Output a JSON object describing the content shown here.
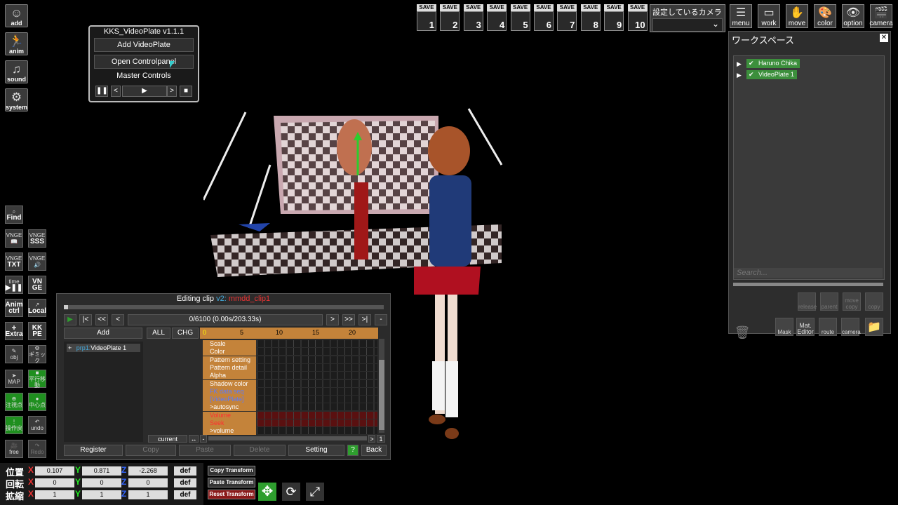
{
  "left_toolbar": [
    {
      "icon": "person-icon",
      "label": "add"
    },
    {
      "icon": "running-figure-icon",
      "label": "anim"
    },
    {
      "icon": "music-note-icon",
      "label": "sound"
    },
    {
      "icon": "gears-icon",
      "label": "system"
    }
  ],
  "left_tools": {
    "find": "Find",
    "vnge": "VNGE",
    "sss": "SSS",
    "txt": "TXT",
    "time": "time",
    "vn": "VN",
    "ge": "GE",
    "anim": "Anim",
    "ctrl": "ctrl",
    "local": "Local",
    "extra": "Extra",
    "kk": "KK",
    "pe": "PE",
    "obj": "obj",
    "gimmick": "ギミック",
    "map": "MAP",
    "move_ctrl": "平行移動",
    "rotate": "注視点",
    "center": "中心点",
    "undo": "undo",
    "undo_label": "操作戻",
    "free": "free",
    "redo": "Redo"
  },
  "save_slots": {
    "label": "SAVE",
    "numbers": [
      "1",
      "2",
      "3",
      "4",
      "5",
      "6",
      "7",
      "8",
      "9",
      "10"
    ]
  },
  "camera_dropdown": {
    "label": "設定しているカメラ",
    "value": ""
  },
  "top_tools": [
    {
      "icon": "menu-icon",
      "label": "menu"
    },
    {
      "icon": "work-icon",
      "label": "work"
    },
    {
      "icon": "hand-icon",
      "label": "move"
    },
    {
      "icon": "palette-icon",
      "label": "color"
    },
    {
      "icon": "eye-icon",
      "label": "option"
    },
    {
      "icon": "camera-clapper-icon",
      "label": "camera"
    }
  ],
  "videoplate": {
    "title": "KKS_VideoPlate v1.1.1",
    "add": "Add VideoPlate",
    "open": "Open Controlpanel",
    "master": "Master Controls",
    "pause": "❚❚",
    "prev": "<",
    "play": "▶",
    "next": ">",
    "stop": "■"
  },
  "clip": {
    "title": "Editing clip",
    "version": "v2:",
    "clip_name": "mmdd_clip1",
    "play": "▶",
    "nav": [
      "|<",
      "<<",
      "<"
    ],
    "time": "0/6100 (0.00s/203.33s)",
    "nav_right": [
      ">",
      ">>",
      ">|",
      "-"
    ],
    "add": "Add",
    "all": "ALL",
    "chg": "CHG",
    "ticks": [
      "0",
      "5",
      "10",
      "15",
      "20"
    ],
    "item_plus": "+",
    "item_prefix": "prp1:",
    "item_name": "VideoPlate 1",
    "props": [
      {
        "name": "Scale",
        "color": "normal"
      },
      {
        "name": "Color",
        "color": "normal"
      },
      {
        "name": "Pattern setting",
        "color": "normal"
      },
      {
        "name": "Pattern detail",
        "color": "normal"
      },
      {
        "name": "Alpha",
        "color": "normal"
      },
      {
        "name": "Shadow color",
        "color": "normal"
      },
      {
        "name": "FK data seq",
        "color": "blue"
      },
      {
        "name": "[VideoPlate]",
        "color": "blue"
      },
      {
        "name": ">autosync",
        "color": "normal"
      },
      {
        "name": "Volume",
        "color": "red"
      },
      {
        "name": "Seek",
        "color": "red"
      },
      {
        "name": ">volume",
        "color": "normal"
      }
    ],
    "current": "current",
    "zoom": "↔",
    "minus": "-",
    "right_end": ">",
    "one": "1",
    "buttons": {
      "register": "Register",
      "copy": "Copy",
      "paste": "Paste",
      "delete": "Delete",
      "setting": "Setting",
      "help": "?",
      "back": "Back"
    }
  },
  "workspace": {
    "title": "ワークスペース",
    "close": "✕",
    "items": [
      "Haruno Chika",
      "VideoPlate 1"
    ],
    "search_placeholder": "Search...",
    "tools": [
      {
        "label": "release",
        "active": false
      },
      {
        "label": "parent",
        "active": false
      },
      {
        "label": "move copy",
        "active": false
      },
      {
        "label": "copy",
        "active": false
      }
    ],
    "bottom": [
      {
        "label": "Mask"
      },
      {
        "label": "Mat. Editor"
      },
      {
        "label": "route"
      },
      {
        "label": "camera"
      }
    ]
  },
  "transform": {
    "position_label": "位置",
    "rotation_label": "回転",
    "scale_label": "拡縮",
    "axis_x": "X",
    "axis_y": "Y",
    "axis_z": "Z",
    "position": [
      "0.107",
      "0.871",
      "-2.268"
    ],
    "rotation": [
      "0",
      "0",
      "0"
    ],
    "scale": [
      "1",
      "1",
      "1"
    ],
    "def": "def",
    "copy": "Copy Transform",
    "paste": "Paste Transform",
    "reset": "Reset Transform"
  },
  "colors": {
    "accent_green": "#2e9e2e",
    "timeline_orange": "#c4833a",
    "panel": "#2b2b2b"
  }
}
